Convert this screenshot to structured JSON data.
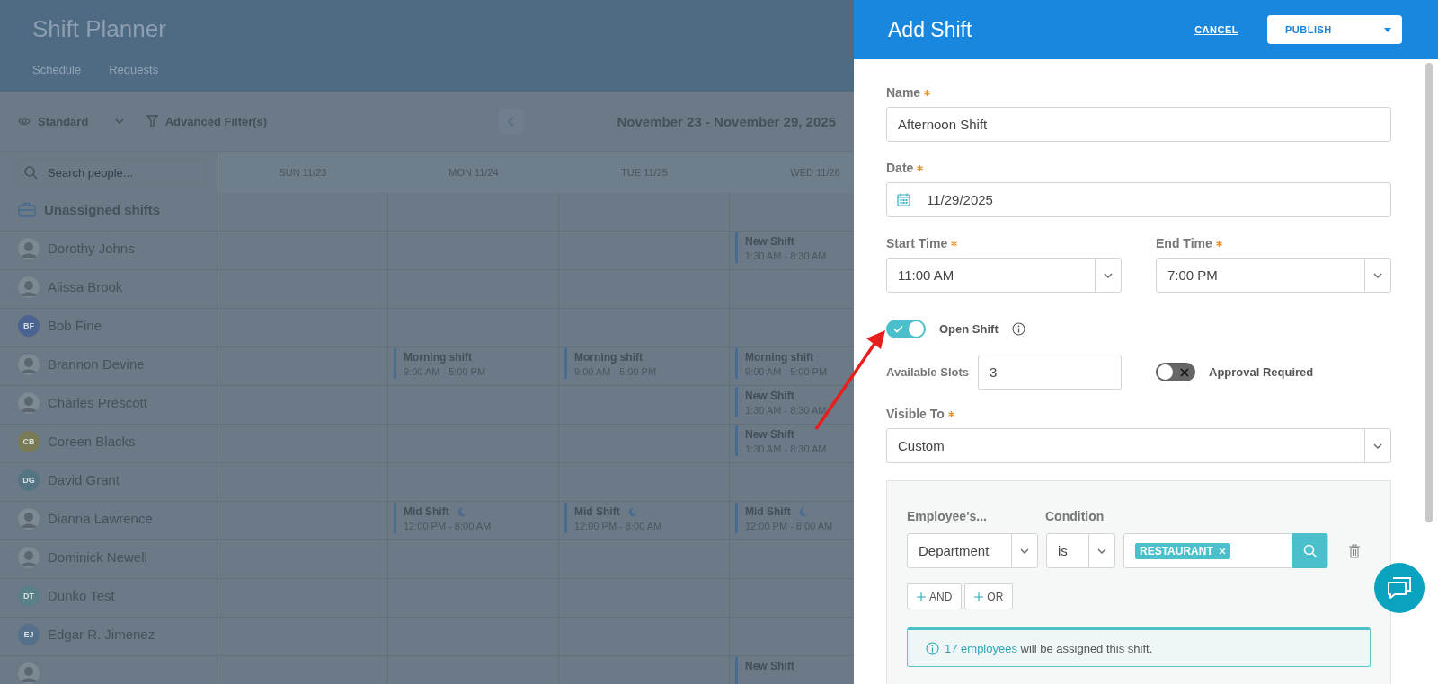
{
  "app": {
    "title": "Shift Planner",
    "tabs": [
      {
        "label": "Schedule"
      },
      {
        "label": "Requests"
      }
    ],
    "view": "Standard",
    "filter": "Advanced Filter(s)",
    "date_range": "November 23 - November 29, 2025",
    "search_placeholder": "Search people...",
    "days": [
      "SUN 11/23",
      "MON 11/24",
      "TUE 11/25",
      "WED 11/26"
    ],
    "unassigned": "Unassigned shifts",
    "rows": [
      {
        "name": "Dorothy Johns",
        "avatar": {
          "kind": "photo"
        },
        "cells": [
          {
            "kind": "empty"
          },
          {
            "kind": "empty"
          },
          {
            "kind": "empty"
          },
          {
            "kind": "shift",
            "title": "New Shift",
            "time": "1:30 AM - 8:30 AM",
            "night": false
          }
        ]
      },
      {
        "name": "Alissa Brook",
        "avatar": {
          "kind": "photo"
        }
      },
      {
        "name": "Bob Fine",
        "avatar": {
          "kind": "initials",
          "initials": "BF",
          "color": "#4a6390"
        }
      },
      {
        "name": "Brannon Devine",
        "avatar": {
          "kind": "photo"
        },
        "cells": [
          {
            "kind": "empty"
          },
          {
            "kind": "shift",
            "title": "Morning shift",
            "time": "9:00 AM - 5:00 PM",
            "night": false
          },
          {
            "kind": "shift",
            "title": "Morning shift",
            "time": "9:00 AM - 5:00 PM",
            "night": false
          },
          {
            "kind": "shift",
            "title": "Morning shift",
            "time": "9:00 AM - 5:00 PM",
            "night": false
          }
        ]
      },
      {
        "name": "Charles Prescott",
        "avatar": {
          "kind": "photo"
        },
        "cells": [
          {
            "kind": "empty"
          },
          {
            "kind": "empty"
          },
          {
            "kind": "empty"
          },
          {
            "kind": "shift",
            "title": "New Shift",
            "time": "1:30 AM - 8:30 AM",
            "night": false
          }
        ]
      },
      {
        "name": "Coreen Blacks",
        "avatar": {
          "kind": "initials",
          "initials": "CB",
          "color": "#7a7a55"
        },
        "cells": [
          {
            "kind": "empty"
          },
          {
            "kind": "empty"
          },
          {
            "kind": "empty"
          },
          {
            "kind": "shift",
            "title": "New Shift",
            "time": "1:30 AM - 8:30 AM",
            "night": false
          }
        ]
      },
      {
        "name": "David Grant",
        "avatar": {
          "kind": "initials",
          "initials": "DG",
          "color": "#557585"
        }
      },
      {
        "name": "Dianna Lawrence",
        "avatar": {
          "kind": "photo"
        },
        "cells": [
          {
            "kind": "empty"
          },
          {
            "kind": "shift",
            "title": "Mid Shift",
            "time": "12:00 PM - 8:00 AM",
            "night": true
          },
          {
            "kind": "shift",
            "title": "Mid Shift",
            "time": "12:00 PM - 8:00 AM",
            "night": true
          },
          {
            "kind": "shift",
            "title": "Mid Shift",
            "time": "12:00 PM - 8:00 AM",
            "night": true
          }
        ]
      },
      {
        "name": "Dominick Newell",
        "avatar": {
          "kind": "photo"
        }
      },
      {
        "name": "Dunko Test",
        "avatar": {
          "kind": "initials",
          "initials": "DT",
          "color": "#5a8088"
        }
      },
      {
        "name": "Edgar R. Jimenez",
        "avatar": {
          "kind": "initials",
          "initials": "EJ",
          "color": "#55708a"
        }
      },
      {
        "avatar": {
          "kind": "photo"
        },
        "cells": [
          {
            "kind": "empty"
          },
          {
            "kind": "empty"
          },
          {
            "kind": "empty"
          },
          {
            "kind": "shift",
            "title": "New Shift",
            "night": false
          }
        ]
      }
    ]
  },
  "panel": {
    "title": "Add Shift",
    "cancel": "CANCEL",
    "publish": "PUBLISH",
    "name": {
      "label": "Name",
      "required": true,
      "value": "Afternoon Shift"
    },
    "date": {
      "label": "Date",
      "required": true,
      "value": "11/29/2025"
    },
    "start_time": {
      "label": "Start Time",
      "required": true,
      "value": "11:00 AM"
    },
    "end_time": {
      "label": "End Time",
      "required": true,
      "value": "7:00 PM"
    },
    "open_shift": {
      "label": "Open Shift",
      "on": true
    },
    "available_slots": {
      "label": "Available Slots",
      "value": "3"
    },
    "approval_required": {
      "label": "Approval Required",
      "on": false
    },
    "visible_to": {
      "label": "Visible To",
      "required": true,
      "value": "Custom"
    },
    "rule_columns": [
      "Employee's...",
      "Condition"
    ],
    "rules": [
      {
        "attribute": "Department",
        "condition": "is",
        "tags": [
          "RESTAURANT"
        ]
      }
    ],
    "add_and": "AND",
    "add_or": "OR",
    "summary": {
      "link": "17 employees",
      "text": "will be assigned this shift."
    }
  }
}
